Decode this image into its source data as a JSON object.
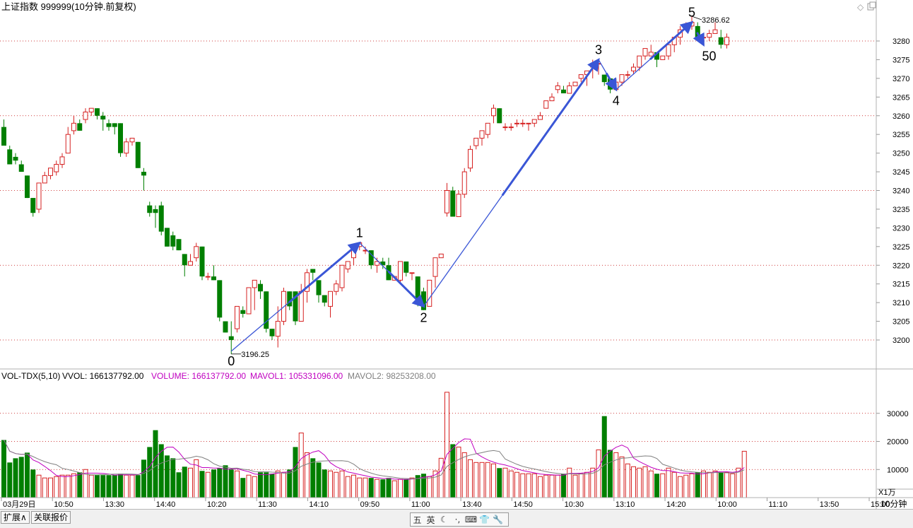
{
  "header": {
    "title": "上证指数 999999(10分钟.前复权)",
    "ctrl_icons": [
      "diamond-icon",
      "restore-icon"
    ]
  },
  "colors": {
    "up": "#d62020",
    "down": "#007f00",
    "arrow": "#3a56d6",
    "volume_text": "#c000c0",
    "mavol1": "#c000c0",
    "mavol2": "#808080",
    "grid": "#c00000",
    "axis": "#999999"
  },
  "chart_data": [
    {
      "type": "candlestick",
      "title": "",
      "ylim": [
        3190,
        3292
      ],
      "yticks": [
        3200,
        3205,
        3210,
        3215,
        3220,
        3225,
        3230,
        3235,
        3240,
        3245,
        3250,
        3255,
        3260,
        3265,
        3270,
        3275,
        3280
      ],
      "grid_levels": [
        3200,
        3220,
        3240,
        3260,
        3280
      ],
      "candles": [
        [
          3257,
          3252,
          3259,
          3253
        ],
        [
          3251,
          3247,
          3252,
          3247
        ],
        [
          3249,
          3248,
          3250,
          3247
        ],
        [
          3247,
          3245,
          3248,
          3245
        ],
        [
          3244,
          3238,
          3244,
          3238
        ],
        [
          3238,
          3234,
          3238,
          3233
        ],
        [
          3235,
          3242,
          3242,
          3234
        ],
        [
          3242,
          3244,
          3245,
          3242
        ],
        [
          3244,
          3246,
          3246,
          3243
        ],
        [
          3245,
          3247,
          3248,
          3244
        ],
        [
          3247,
          3249,
          3250,
          3246
        ],
        [
          3250,
          3255,
          3257,
          3250
        ],
        [
          3256,
          3258,
          3260,
          3255
        ],
        [
          3258,
          3256,
          3259,
          3256
        ],
        [
          3259,
          3261,
          3262,
          3258
        ],
        [
          3261,
          3262,
          3262,
          3260
        ],
        [
          3262,
          3260,
          3262,
          3259
        ],
        [
          3260,
          3259,
          3261,
          3256
        ],
        [
          3258,
          3257,
          3259,
          3256
        ],
        [
          3258,
          3257,
          3258,
          3255
        ],
        [
          3258,
          3250,
          3258,
          3249
        ],
        [
          3250,
          3253,
          3254,
          3249
        ],
        [
          3253,
          3254,
          3254,
          3252
        ],
        [
          3253,
          3246,
          3253,
          3246
        ],
        [
          3245,
          3244,
          3246,
          3240
        ],
        [
          3236,
          3234,
          3237,
          3233
        ],
        [
          3235,
          3234,
          3236,
          3230
        ],
        [
          3236,
          3229,
          3237,
          3228
        ],
        [
          3230,
          3225,
          3230,
          3225
        ],
        [
          3228,
          3225,
          3229,
          3224
        ],
        [
          3227,
          3224,
          3227,
          3224
        ],
        [
          3223,
          3220,
          3223,
          3217
        ],
        [
          3220,
          3221,
          3223,
          3220
        ],
        [
          3222,
          3225,
          3226,
          3221
        ],
        [
          3225,
          3217,
          3225,
          3216
        ],
        [
          3217,
          3217,
          3218,
          3216
        ],
        [
          3217,
          3216,
          3220,
          3216
        ],
        [
          3216,
          3206,
          3216,
          3205
        ],
        [
          3205,
          3202,
          3205,
          3202
        ],
        [
          3201,
          3200,
          3205,
          3196.25
        ],
        [
          3203,
          3209,
          3209,
          3202
        ],
        [
          3208,
          3207,
          3209,
          3206
        ],
        [
          3207,
          3214,
          3214,
          3207
        ],
        [
          3214,
          3216,
          3216,
          3208
        ],
        [
          3215,
          3213,
          3216,
          3211
        ],
        [
          3213,
          3203,
          3213,
          3202
        ],
        [
          3203,
          3201,
          3203,
          3200
        ],
        [
          3201,
          3205,
          3209,
          3198
        ],
        [
          3205,
          3213,
          3214,
          3204
        ],
        [
          3213,
          3209,
          3213,
          3208
        ],
        [
          3213,
          3205,
          3213,
          3204
        ],
        [
          3205,
          3213,
          3215,
          3205
        ],
        [
          3213,
          3218,
          3219,
          3210
        ],
        [
          3219,
          3218,
          3219,
          3216
        ],
        [
          3216,
          3212,
          3216,
          3210
        ],
        [
          3212,
          3210,
          3212,
          3209
        ],
        [
          3209,
          3213,
          3213,
          3206
        ],
        [
          3213,
          3215,
          3216,
          3212
        ],
        [
          3214,
          3220,
          3220,
          3213
        ],
        [
          3219,
          3221,
          3221,
          3218
        ],
        [
          3222,
          3225,
          3225,
          3220
        ],
        [
          3225,
          3226,
          3226,
          3224
        ],
        [
          3224,
          3224,
          3225,
          3223
        ],
        [
          3224,
          3220,
          3224,
          3219
        ],
        [
          3220,
          3221,
          3222,
          3218
        ],
        [
          3221,
          3220,
          3222,
          3219
        ],
        [
          3220,
          3216,
          3222,
          3216
        ],
        [
          3216,
          3217,
          3217,
          3216
        ],
        [
          3216,
          3221,
          3221,
          3215
        ],
        [
          3221,
          3218,
          3221,
          3217
        ],
        [
          3218,
          3218,
          3218,
          3216
        ],
        [
          3217,
          3211,
          3217,
          3209
        ],
        [
          3213,
          3208,
          3214,
          3208
        ],
        [
          3209,
          3216,
          3216,
          3209
        ],
        [
          3217,
          3222,
          3222,
          3214
        ],
        [
          3222,
          3223,
          3223,
          3222
        ],
        [
          3234,
          3240,
          3242,
          3233
        ],
        [
          3240,
          3233,
          3241,
          3233
        ],
        [
          3233,
          3239,
          3240,
          3233
        ],
        [
          3239,
          3245,
          3246,
          3238
        ],
        [
          3246,
          3251,
          3252,
          3245
        ],
        [
          3252,
          3254,
          3254,
          3251
        ],
        [
          3254,
          3256,
          3256,
          3252
        ],
        [
          3255,
          3258,
          3258,
          3254
        ],
        [
          3260,
          3262,
          3263,
          3258
        ],
        [
          3262,
          3258,
          3262,
          3258
        ],
        [
          3257,
          3257,
          3258,
          3256
        ],
        [
          3257,
          3257,
          3258,
          3256
        ],
        [
          3258,
          3258,
          3259,
          3257
        ],
        [
          3258,
          3258,
          3259,
          3257
        ],
        [
          3258,
          3258,
          3258,
          3256
        ],
        [
          3258,
          3259,
          3259,
          3257
        ],
        [
          3259,
          3260,
          3261,
          3259
        ],
        [
          3262,
          3264,
          3264,
          3262
        ],
        [
          3264,
          3265,
          3266,
          3264
        ],
        [
          3267,
          3268,
          3269,
          3266
        ],
        [
          3267,
          3266,
          3268,
          3266
        ],
        [
          3266,
          3268,
          3269,
          3266
        ],
        [
          3268,
          3269,
          3269,
          3268
        ],
        [
          3270,
          3271,
          3271,
          3269
        ],
        [
          3271,
          3272,
          3272,
          3268
        ],
        [
          3273,
          3274,
          3275,
          3270
        ],
        [
          3274,
          3274,
          3275,
          3271
        ],
        [
          3271,
          3269,
          3271,
          3268
        ],
        [
          3270,
          3267,
          3270,
          3266
        ],
        [
          3267,
          3269,
          3270,
          3267
        ],
        [
          3269,
          3271,
          3271,
          3268
        ],
        [
          3271,
          3271,
          3272,
          3270
        ],
        [
          3272,
          3273,
          3274,
          3271
        ],
        [
          3273,
          3276,
          3276,
          3272
        ],
        [
          3276,
          3278,
          3278,
          3275
        ],
        [
          3276,
          3277,
          3279,
          3276
        ],
        [
          3277,
          3275,
          3277,
          3273
        ],
        [
          3275,
          3276,
          3276,
          3275
        ],
        [
          3276,
          3279,
          3279,
          3275
        ],
        [
          3279,
          3281,
          3281,
          3277
        ],
        [
          3281,
          3283,
          3284,
          3279
        ],
        [
          3283,
          3284,
          3285,
          3283
        ],
        [
          3284,
          3285,
          3286.62,
          3283
        ],
        [
          3284,
          3281,
          3285,
          3280
        ],
        [
          3281,
          3281,
          3282,
          3280
        ],
        [
          3281,
          3282,
          3283,
          3280
        ],
        [
          3282,
          3283,
          3285,
          3282
        ],
        [
          3281,
          3279,
          3283,
          3278
        ],
        [
          3279,
          3281,
          3282,
          3278
        ]
      ],
      "annotations": {
        "low_label": "3196.25",
        "high_label": "3286.62",
        "wave_points": [
          {
            "label": "0",
            "index": 39,
            "value": 3197
          },
          {
            "label": "1",
            "index": 61,
            "value": 3226
          },
          {
            "label": "2",
            "index": 72,
            "value": 3209
          },
          {
            "label": "3",
            "index": 102,
            "value": 3275
          },
          {
            "label": "4",
            "index": 105,
            "value": 3267
          },
          {
            "label": "5",
            "index": 118,
            "value": 3285
          },
          {
            "label": "50",
            "index": 120,
            "value": 3279
          }
        ],
        "thin_segments": [
          [
            0,
            1
          ],
          [
            1,
            2
          ],
          [
            2,
            3
          ],
          [
            3,
            4
          ],
          [
            4,
            5
          ]
        ],
        "thick_segments": [
          [
            0,
            1
          ],
          [
            1,
            2
          ],
          [
            2,
            3
          ],
          [
            3,
            4
          ],
          [
            4,
            5
          ],
          [
            5,
            6
          ]
        ]
      }
    },
    {
      "type": "bar",
      "title": "",
      "indicator": "VOL-TDX(5,10)",
      "legend": [
        {
          "label": "VVOL: 166137792.00"
        },
        {
          "label": "VOLUME: 166137792.00"
        },
        {
          "label": "MAVOL1: 105331096.00"
        },
        {
          "label": "MAVOL2: 98253208.00"
        }
      ],
      "ylim": [
        0,
        40000
      ],
      "yticks": [
        10000,
        20000,
        30000
      ],
      "unit_label": "X1万",
      "series": [
        {
          "name": "VOLUME",
          "values": [
            20500,
            12500,
            14000,
            14500,
            16000,
            10000,
            8000,
            7000,
            7000,
            7500,
            8000,
            8000,
            8500,
            9000,
            10000,
            8000,
            8000,
            8000,
            8000,
            8000,
            8500,
            8000,
            8000,
            8000,
            13500,
            18000,
            24000,
            19000,
            15000,
            14000,
            9000,
            11000,
            10500,
            13500,
            9500,
            9000,
            10000,
            10500,
            11500,
            10000,
            9500,
            7000,
            8000,
            7500,
            9000,
            9000,
            8500,
            9500,
            9000,
            10000,
            18000,
            23000,
            16000,
            14000,
            12500,
            10000,
            9500,
            9000,
            9500,
            7500,
            8000,
            7000,
            7000,
            7000,
            6500,
            6500,
            7000,
            6000,
            6500,
            6500,
            7000,
            8000,
            8500,
            7500,
            9500,
            14000,
            37500,
            19000,
            18000,
            16000,
            13500,
            12500,
            12500,
            12500,
            12000,
            10500,
            10500,
            9500,
            9000,
            8500,
            8500,
            8500,
            7500,
            8000,
            8000,
            8000,
            8500,
            10500,
            8000,
            8500,
            9000,
            10500,
            17000,
            29000,
            17000,
            16000,
            14500,
            12000,
            11000,
            10500,
            11000,
            9500,
            8500,
            8500,
            10500,
            9000,
            7500,
            8000,
            8500,
            9000,
            9500,
            9000,
            9500,
            9000,
            9000,
            8500,
            10500,
            16500
          ]
        }
      ],
      "x_time_labels": [
        "03月29日",
        "10:50",
        "13:30",
        "14:40",
        "10:20",
        "11:30",
        "14:10",
        "09:50",
        "11:00",
        "13:40",
        "14:50",
        "10:30",
        "13:10",
        "14:20",
        "10:00",
        "11:10",
        "13:50",
        "15:00"
      ],
      "period_label": "10分钟"
    }
  ],
  "bottom": {
    "tabs": [
      "扩展∧",
      "关联报价"
    ],
    "ime_icons": [
      "五",
      "英",
      "☾",
      "·,",
      "⌨",
      "👕",
      "🔧"
    ]
  }
}
